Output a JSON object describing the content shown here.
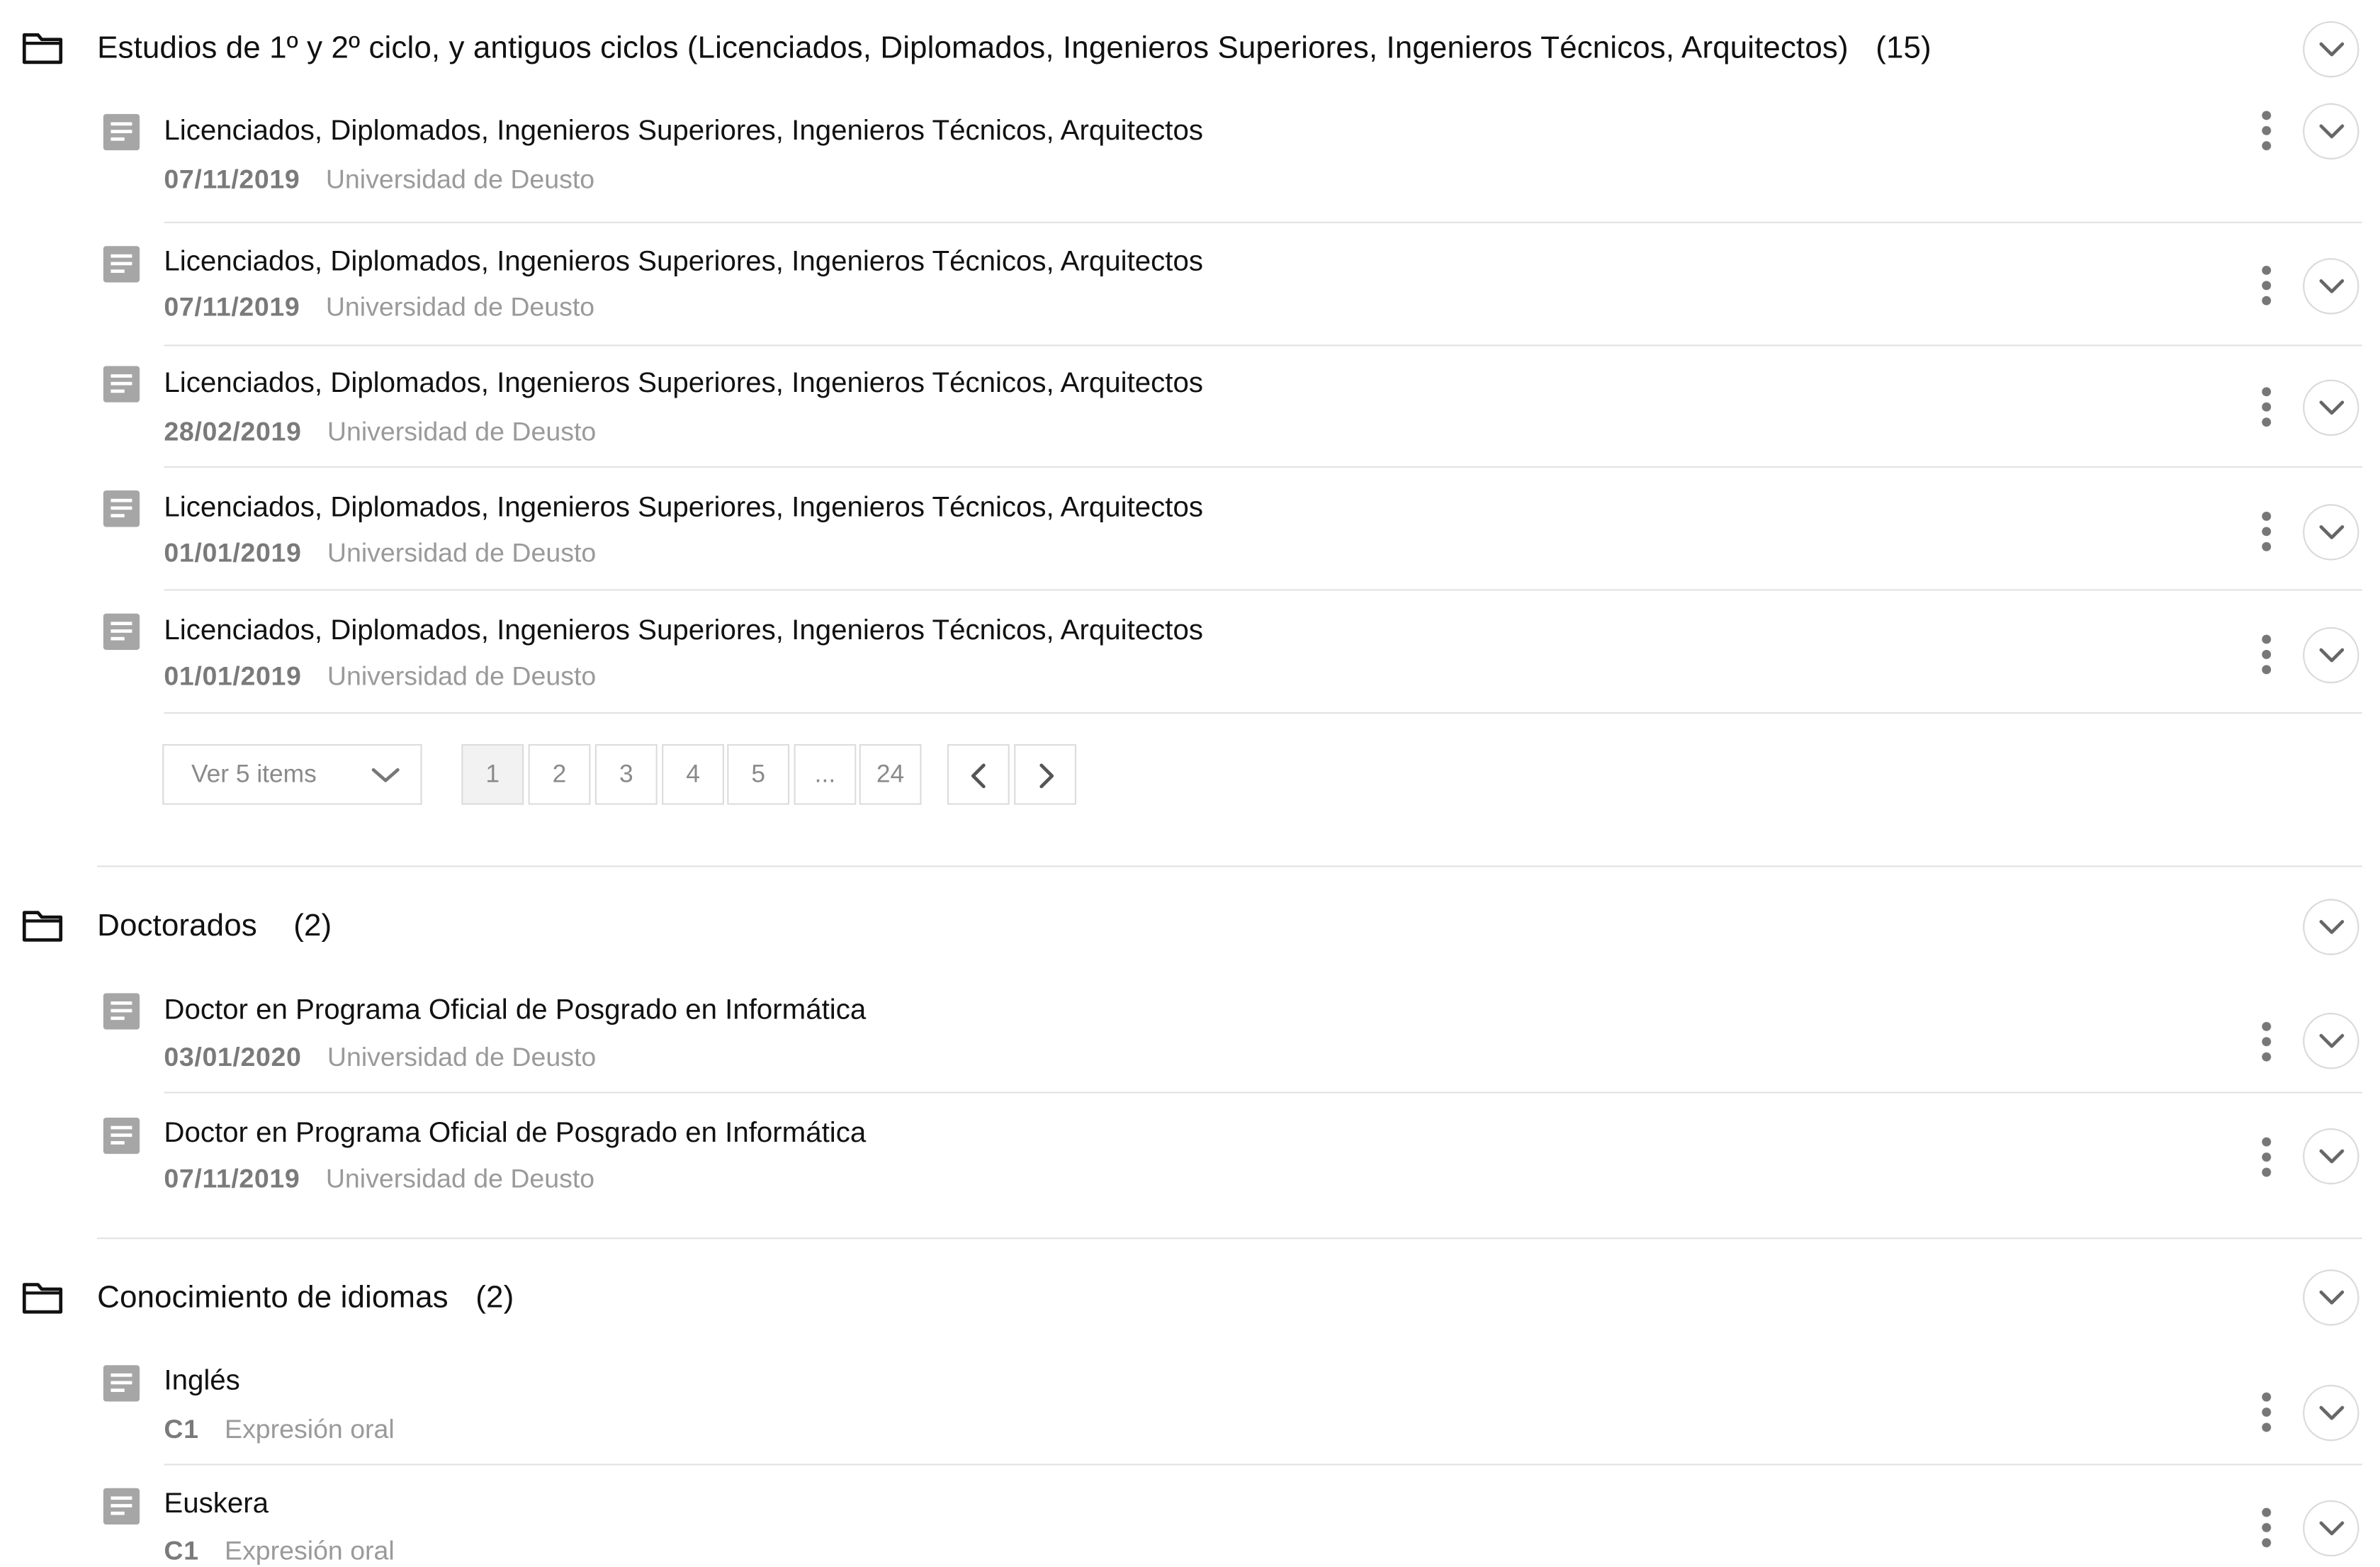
{
  "sections": [
    {
      "title": "Estudios de 1º y 2º ciclo, y antiguos ciclos (Licenciados, Diplomados, Ingenieros Superiores, Ingenieros Técnicos, Arquitectos)",
      "count": "(15)",
      "items": [
        {
          "title": "Licenciados, Diplomados, Ingenieros Superiores, Ingenieros Técnicos, Arquitectos",
          "meta_a": "07/11/2019",
          "meta_b": "Universidad de Deusto"
        },
        {
          "title": "Licenciados, Diplomados, Ingenieros Superiores, Ingenieros Técnicos, Arquitectos",
          "meta_a": "07/11/2019",
          "meta_b": "Universidad de Deusto"
        },
        {
          "title": "Licenciados, Diplomados, Ingenieros Superiores, Ingenieros Técnicos, Arquitectos",
          "meta_a": "28/02/2019",
          "meta_b": "Universidad de Deusto"
        },
        {
          "title": "Licenciados, Diplomados, Ingenieros Superiores, Ingenieros Técnicos, Arquitectos",
          "meta_a": "01/01/2019",
          "meta_b": "Universidad de Deusto"
        },
        {
          "title": "Licenciados, Diplomados, Ingenieros Superiores, Ingenieros Técnicos, Arquitectos",
          "meta_a": "01/01/2019",
          "meta_b": "Universidad de Deusto"
        }
      ],
      "pagination": {
        "page_size_label": "Ver 5 items",
        "pages": [
          "1",
          "2",
          "3",
          "4",
          "5",
          "...",
          "24"
        ],
        "current_page": "1"
      }
    },
    {
      "title": "Doctorados",
      "count": "(2)",
      "items": [
        {
          "title": "Doctor en Programa Oficial de Posgrado en Informática",
          "meta_a": "03/01/2020",
          "meta_b": "Universidad de Deusto"
        },
        {
          "title": "Doctor en Programa Oficial de Posgrado en Informática",
          "meta_a": "07/11/2019",
          "meta_b": "Universidad de Deusto"
        }
      ]
    },
    {
      "title": "Conocimiento de idiomas",
      "count": "(2)",
      "items": [
        {
          "title": "Inglés",
          "meta_a": "C1",
          "meta_b": "Expresión oral"
        },
        {
          "title": "Euskera",
          "meta_a": "C1",
          "meta_b": "Expresión oral"
        }
      ]
    }
  ],
  "icons": {
    "section": "folder-icon",
    "item": "document-icon",
    "expand": "chevron-down-icon",
    "more": "more-vertical-icon",
    "prev": "chevron-left-icon",
    "next": "chevron-right-icon"
  },
  "colors": {
    "text": "#111111",
    "muted_bold": "#7a7a7a",
    "muted": "#9a9a9a",
    "icon_gray": "#a6a6a6",
    "border": "#dcdcdc",
    "active_page_bg": "#f2f2f2"
  }
}
